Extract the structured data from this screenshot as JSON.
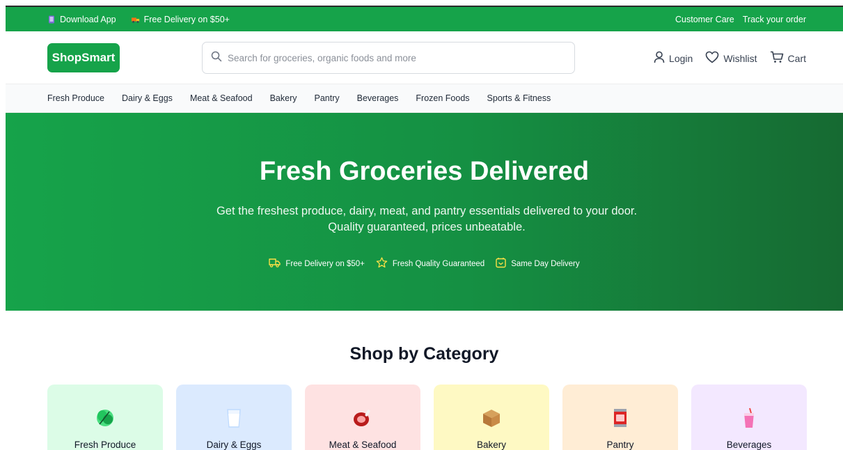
{
  "topbar": {
    "download_app": "Download App",
    "free_delivery": "Free Delivery on $50+",
    "customer_care": "Customer Care",
    "track_order": "Track your order"
  },
  "header": {
    "logo": "ShopSmart",
    "search_placeholder": "Search for groceries, organic foods and more",
    "login": "Login",
    "wishlist": "Wishlist",
    "cart": "Cart"
  },
  "category_nav": [
    "Fresh Produce",
    "Dairy & Eggs",
    "Meat & Seafood",
    "Bakery",
    "Pantry",
    "Beverages",
    "Frozen Foods",
    "Sports & Fitness"
  ],
  "hero": {
    "title": "Fresh Groceries Delivered",
    "subtitle": "Get the freshest produce, dairy, meat, and pantry essentials delivered to your door. Quality guaranteed, prices unbeatable.",
    "features": [
      {
        "icon": "truck-icon",
        "label": "Free Delivery on $50+"
      },
      {
        "icon": "star-icon",
        "label": "Fresh Quality Guaranteed"
      },
      {
        "icon": "calendar-icon",
        "label": "Same Day Delivery"
      }
    ]
  },
  "categories_section": {
    "title": "Shop by Category",
    "cards": [
      {
        "label": "Fresh Produce",
        "icon": "leafy-greens-icon",
        "bg": "#dcfce7"
      },
      {
        "label": "Dairy & Eggs",
        "icon": "milk-glass-icon",
        "bg": "#dbeafe"
      },
      {
        "label": "Meat & Seafood",
        "icon": "meat-icon",
        "bg": "#fee2e2"
      },
      {
        "label": "Bakery",
        "icon": "bread-box-icon",
        "bg": "#fef9c3"
      },
      {
        "label": "Pantry",
        "icon": "canned-food-icon",
        "bg": "#ffedd5"
      },
      {
        "label": "Beverages",
        "icon": "cup-with-straw-icon",
        "bg": "#f3e8ff"
      }
    ]
  },
  "colors": {
    "brand": "#16a34a",
    "hero_end": "#166a32",
    "feature_icon": "#fde047"
  }
}
